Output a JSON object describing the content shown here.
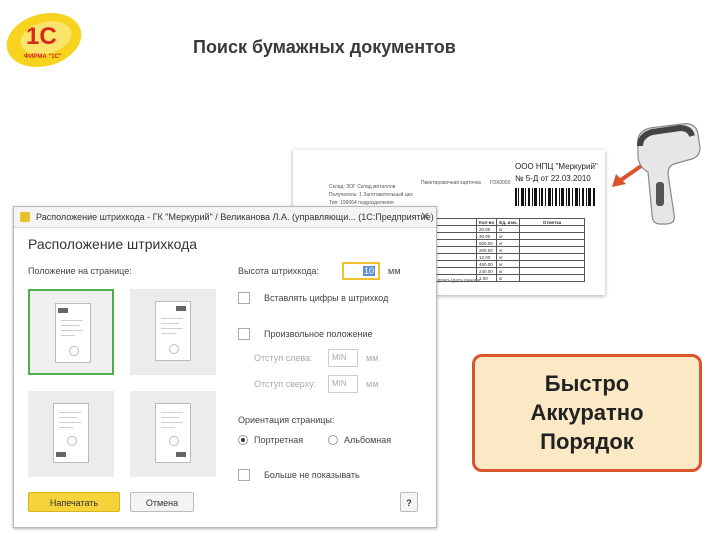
{
  "logo": {
    "brand": "1С",
    "sub": "ФИРМА \"1С\""
  },
  "slide_title": "Поиск бумажных документов",
  "doc": {
    "heading": "Пикетировочная карточка",
    "doc_code": "ГОК0000",
    "org": "ООО НПЦ \"Меркурий\"",
    "number": "№ 5-Д от 22.03.2010",
    "meta": [
      "Склад:  ЗОГ Склад металлов",
      "Получатель:  1 Заготовительный цех",
      "Тип:  199064 подразделения"
    ],
    "table_header": [
      "Кол-во",
      "Ед. изм.",
      "Отметка"
    ],
    "table_rows": [
      [
        "20.00",
        "кг"
      ],
      [
        "30.00",
        "кг"
      ],
      [
        "600.00",
        "кг"
      ],
      [
        "200.00",
        "кг"
      ],
      [
        "12.00",
        "кг"
      ],
      [
        "460.00",
        "кг"
      ],
      [
        "240.00",
        "кг"
      ],
      [
        "1.00",
        "кг"
      ]
    ],
    "signature": "Подпись/дата печати"
  },
  "window": {
    "title": "Расположение штрихкода - ГК \"Меркурий\" / Великанова Л.А. (управляющи... (1С:Предприятие)",
    "form_title": "Расположение штрихкода",
    "position_label": "Положение на странице:",
    "height_label": "Высота штрихкода:",
    "height_value": "10",
    "height_unit": "мм",
    "insert_digits": "Вставлять цифры в штрихкод",
    "custom_position": "Произвольное положение",
    "offset_left_label": "Отступ слева:",
    "offset_left_value": "MIN",
    "offset_top_label": "Отступ сверху:",
    "offset_top_value": "MIN",
    "offset_unit": "мм",
    "orientation_label": "Ориентация страницы:",
    "portrait": "Портретная",
    "landscape": "Альбомная",
    "dont_show": "Больше не показывать",
    "print_button": "Напечатать",
    "cancel_button": "Отмена",
    "help_button": "?"
  },
  "benefits": [
    "Быстро",
    "Аккуратно",
    "Порядок"
  ],
  "colors": {
    "accent_yellow": "#f6d33b",
    "selected_green": "#4caf50",
    "callout_border": "#d9532b",
    "callout_fill": "#fbe9c5"
  }
}
